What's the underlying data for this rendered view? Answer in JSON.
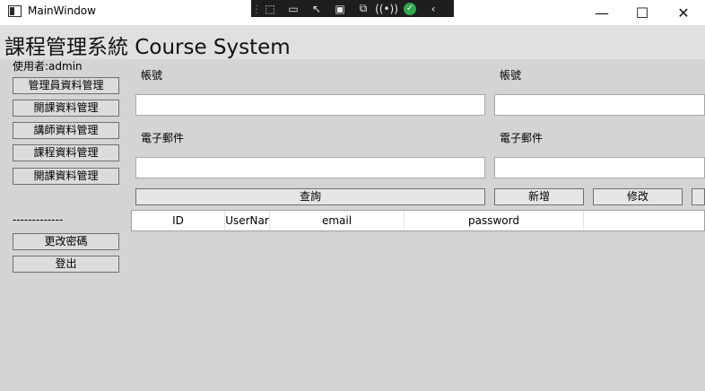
{
  "window": {
    "title": "MainWindow",
    "minimize": "—",
    "maximize": "☐",
    "close": "✕"
  },
  "debug_toolbar": {
    "icons": [
      "select-element",
      "record",
      "pointer",
      "frame",
      "tracking",
      "hot-reload",
      "ok",
      "collapse"
    ]
  },
  "header": {
    "title": "課程管理系統 Course System"
  },
  "sidebar": {
    "user": "使用者:admin",
    "items": [
      {
        "label": "管理員資料管理"
      },
      {
        "label": "開課資料管理"
      },
      {
        "label": "講師資料管理"
      },
      {
        "label": "課程資料管理"
      },
      {
        "label": "開課資料管理"
      }
    ],
    "separator": "-------------",
    "change_password": "更改密碼",
    "logout": "登出"
  },
  "form": {
    "left": {
      "account_label": "帳號",
      "account_value": "",
      "email_label": "電子郵件",
      "email_value": ""
    },
    "right": {
      "account_label": "帳號",
      "account_value": "",
      "email_label": "電子郵件",
      "email_value": ""
    },
    "query_label": "查詢",
    "add_label": "新增",
    "edit_label": "修改",
    "extra_label": ""
  },
  "grid": {
    "columns": [
      "ID",
      "UserNar",
      "email",
      "password",
      ""
    ]
  }
}
